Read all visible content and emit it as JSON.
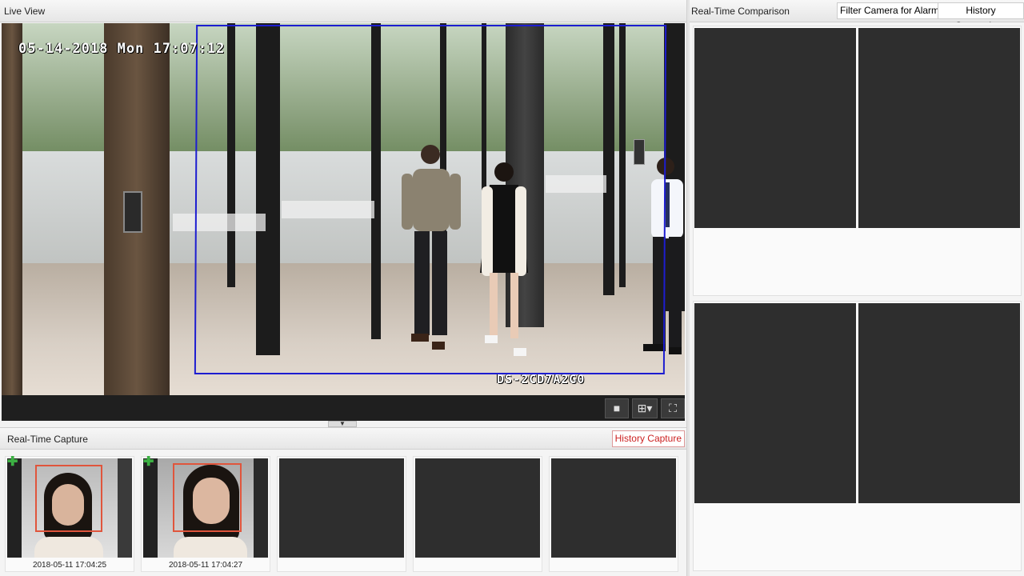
{
  "live_view": {
    "title": "Live View",
    "osd_timestamp": "05-14-2018 Mon 17:07:12",
    "osd_camera_model": "DS-2CD7A2G0"
  },
  "toolbar": {
    "stop_icon": "stop-icon",
    "layout_icon": "window-layout-icon",
    "fullscreen_icon": "fullscreen-icon"
  },
  "capture": {
    "title": "Real-Time Capture",
    "history_button": "History Capture",
    "items": [
      {
        "time": "2018-05-11 17:04:25",
        "has_face": true
      },
      {
        "time": "2018-05-11 17:04:27",
        "has_face": true
      },
      {
        "time": "",
        "has_face": false
      },
      {
        "time": "",
        "has_face": false
      },
      {
        "time": "",
        "has_face": false
      }
    ]
  },
  "comparison": {
    "title": "Real-Time Comparison",
    "filter_button": "Filter Camera for Alarm",
    "history_button": "History Comparison"
  },
  "colors": {
    "roi_box": "#1d1dd0",
    "face_box": "#e0553c",
    "add_icon": "#3cb043",
    "history_capture_text": "#c22222"
  }
}
